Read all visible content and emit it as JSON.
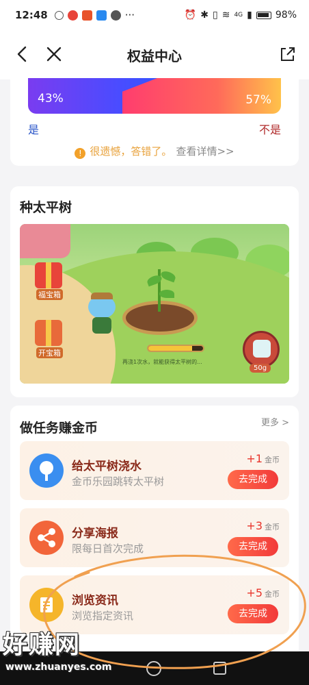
{
  "status_bar": {
    "time": "12:48",
    "battery": "98%",
    "network": "4G"
  },
  "header": {
    "title": "权益中心"
  },
  "quiz": {
    "left_percent": "43%",
    "right_percent": "57%",
    "left_label": "是",
    "right_label": "不是",
    "result_text": "很遗憾，答错了。",
    "detail_link": "查看详情>>",
    "colors": {
      "yes": "#2a55c8",
      "no": "#b02a2a",
      "warn": "#e8a23c"
    }
  },
  "tree": {
    "title": "种太平树",
    "left_gift_1": "福宝箱",
    "left_gift_2": "开宝箱",
    "tip": "再浇1次水，就能获得太平树的...",
    "kettle_amount": "50g",
    "water_progress": 0.8
  },
  "tasks": {
    "title": "做任务赚金币",
    "more": "更多 >",
    "items": [
      {
        "name": "给太平树浇水",
        "desc": "金币乐园跳转太平树",
        "reward": "+1",
        "unit": "金币",
        "button": "去完成",
        "icon": "tree-icon",
        "icon_color": "#3a8ef0"
      },
      {
        "name": "分享海报",
        "desc": "限每日首次完成",
        "reward": "+3",
        "unit": "金币",
        "button": "去完成",
        "icon": "share-icon",
        "icon_color": "#f2653a"
      },
      {
        "name": "浏览资讯",
        "desc": "浏览指定资讯",
        "reward": "+5",
        "unit": "金币",
        "button": "去完成",
        "icon": "document-icon",
        "icon_color": "#f5b52a"
      }
    ]
  },
  "watermark": {
    "title": "好赚网",
    "url": "www.zhuanyes.com"
  },
  "accent_color": "#f23a3a"
}
